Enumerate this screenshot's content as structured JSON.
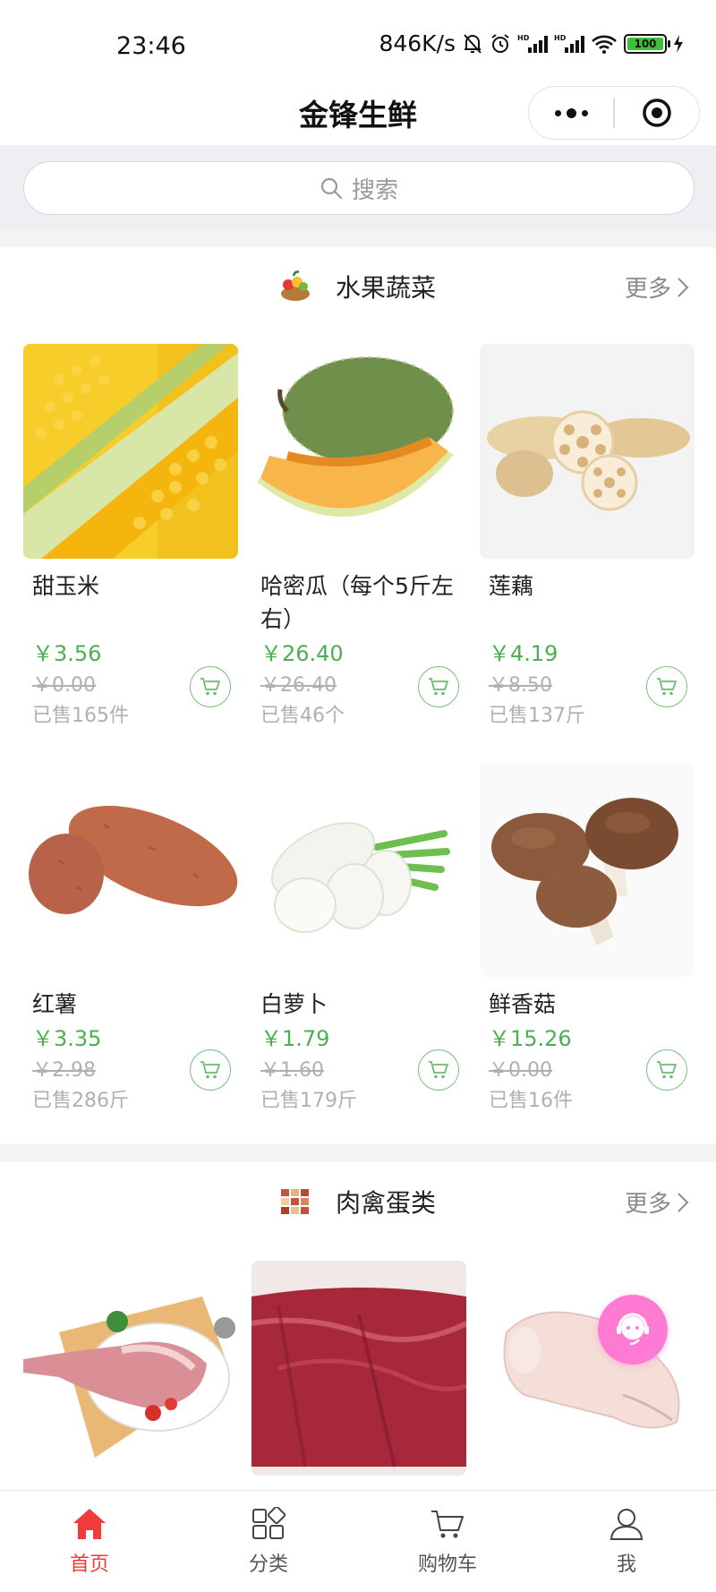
{
  "status_bar": {
    "time": "23:46",
    "net_speed": "846K/s",
    "battery": "100"
  },
  "nav": {
    "title": "金锋生鲜"
  },
  "search": {
    "placeholder": "搜索"
  },
  "sections": [
    {
      "title": "水果蔬菜",
      "more": "更多",
      "products": [
        {
          "name": "甜玉米",
          "price": "￥3.56",
          "original": "￥0.00",
          "sold": "已售165件"
        },
        {
          "name": "哈密瓜（每个5斤左右）",
          "price": "￥26.40",
          "original": "￥26.40",
          "sold": "已售46个"
        },
        {
          "name": "莲藕",
          "price": "￥4.19",
          "original": "￥8.50",
          "sold": "已售137斤"
        },
        {
          "name": "红薯",
          "price": "￥3.35",
          "original": "￥2.98",
          "sold": "已售286斤"
        },
        {
          "name": "白萝卜",
          "price": "￥1.79",
          "original": "￥1.60",
          "sold": "已售179斤"
        },
        {
          "name": "鲜香菇",
          "price": "￥15.26",
          "original": "￥0.00",
          "sold": "已售16件"
        }
      ]
    },
    {
      "title": "肉禽蛋类",
      "more": "更多"
    }
  ],
  "tabbar": [
    {
      "label": "首页",
      "icon": "home-icon",
      "active": true
    },
    {
      "label": "分类",
      "icon": "category-icon",
      "active": false
    },
    {
      "label": "购物车",
      "icon": "cart-icon",
      "active": false
    },
    {
      "label": "我",
      "icon": "user-icon",
      "active": false
    }
  ],
  "colors": {
    "accent_green": "#4caf50",
    "active_red": "#f03b3b",
    "float_pink": "#ff7ad3"
  }
}
